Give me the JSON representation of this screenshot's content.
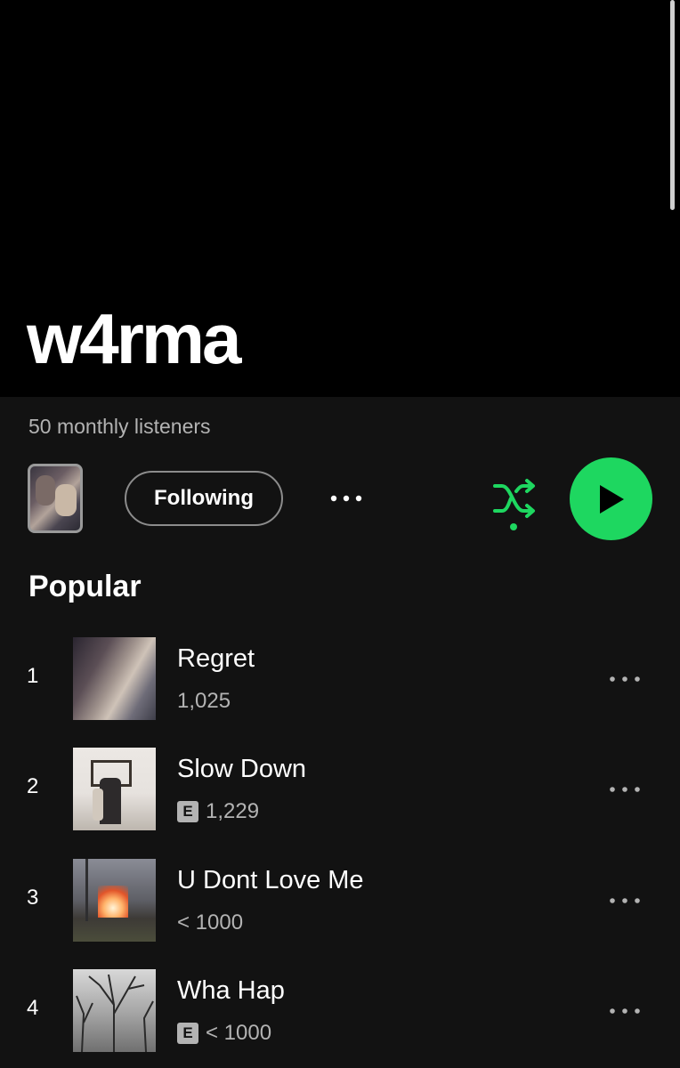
{
  "artist": {
    "name": "w4rma",
    "monthly_listeners": "50 monthly listeners"
  },
  "actions": {
    "follow_label": "Following",
    "more_icon": "more-horizontal-icon",
    "shuffle_icon": "shuffle-icon",
    "play_icon": "play-icon"
  },
  "section": {
    "title": "Popular"
  },
  "tracks": [
    {
      "rank": "1",
      "title": "Regret",
      "plays": "1,025",
      "explicit": false
    },
    {
      "rank": "2",
      "title": "Slow Down",
      "plays": "1,229",
      "explicit": true
    },
    {
      "rank": "3",
      "title": "U Dont Love Me",
      "plays": "< 1000",
      "explicit": false
    },
    {
      "rank": "4",
      "title": "Wha Hap",
      "plays": "< 1000",
      "explicit": true
    }
  ],
  "explicit_label": "E",
  "colors": {
    "accent": "#1ed760",
    "background": "#121212",
    "header_background": "#000000",
    "secondary_text": "#b3b3b3"
  }
}
